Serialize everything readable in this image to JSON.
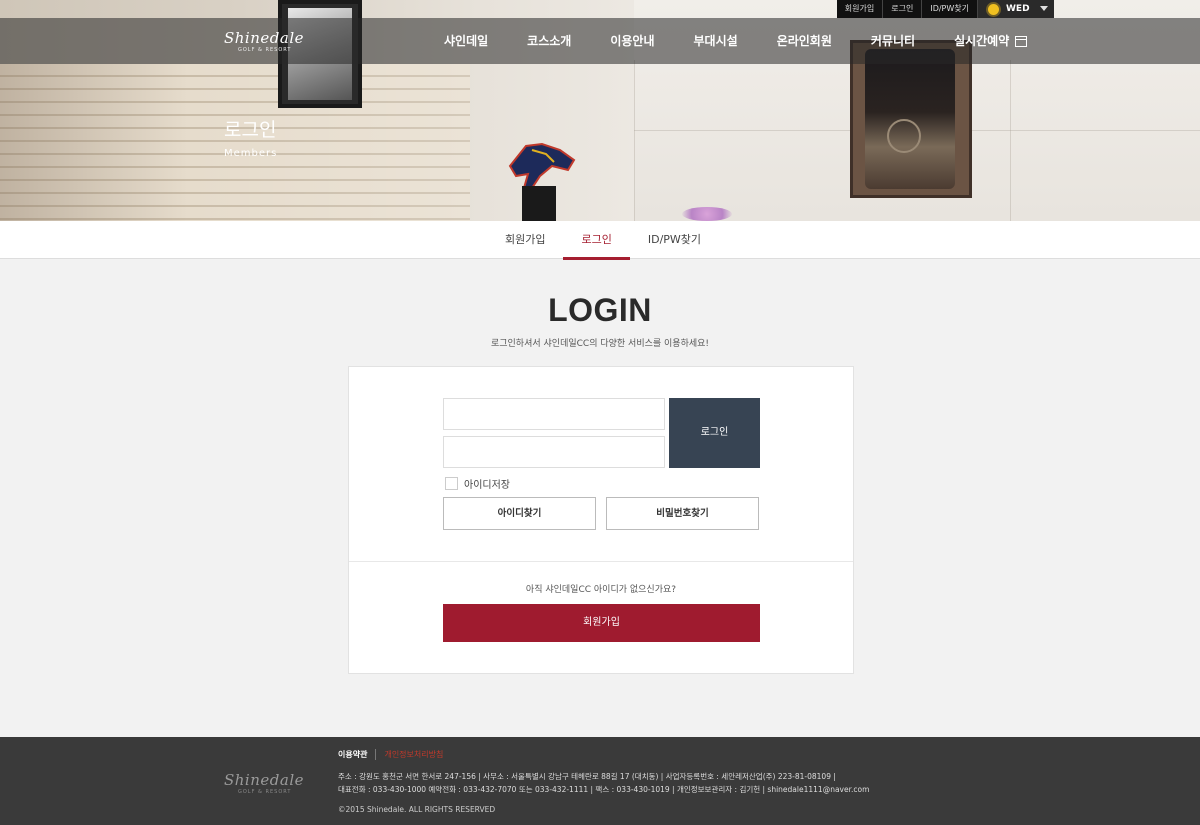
{
  "util": {
    "links": [
      "회원가입",
      "로그인",
      "ID/PW찾기"
    ],
    "weather": "WED"
  },
  "brand": {
    "logo": "Shinedale",
    "logo_sub": "GOLF & RESORT"
  },
  "nav": {
    "items": [
      "샤인데일",
      "코스소개",
      "이용안내",
      "부대시설",
      "온라인회원",
      "커뮤니티"
    ],
    "reserve": "실시간예약"
  },
  "hero": {
    "title": "로그인",
    "subtitle": "Members"
  },
  "tabs": {
    "items": [
      "회원가입",
      "로그인",
      "ID/PW찾기"
    ],
    "active": "로그인"
  },
  "login": {
    "title": "LOGIN",
    "description": "로그인하셔서 샤인데일CC의 다양한 서비스를 이용하세요!",
    "id_value": "",
    "pw_value": "",
    "login_button": "로그인",
    "save_id_label": "아이디저장",
    "find_id": "아이디찾기",
    "find_pw": "비밀번호찾기",
    "no_account": "아직 샤인데일CC 아이디가 없으신가요?",
    "join_button": "회원가입"
  },
  "footer": {
    "terms": "이용약관",
    "privacy": "개인정보처리방침",
    "line1": "주소 : 강원도 홍천군 서면 한서로 247-156  |  사무소 : 서울특별시 강남구 테헤란로 88길 17 (대치동)  |  사업자등록번호 : 세안레저산업(주) 223-81-08109  |",
    "line2": "대표전화 : 033-430-1000 예약전화 : 033-432-7070 또는 033-432-1111  |  팩스 : 033-430-1019  |  개인정보보관리자 : 김기헌  |  shinedale1111@naver.com",
    "copyright": "©2015 Shinedale. ALL RIGHTS RESERVED"
  },
  "colors": {
    "accent": "#a51e30",
    "login_button": "#374453",
    "join_button": "#9f1b2f",
    "footer_bg": "#3a3a3a"
  }
}
